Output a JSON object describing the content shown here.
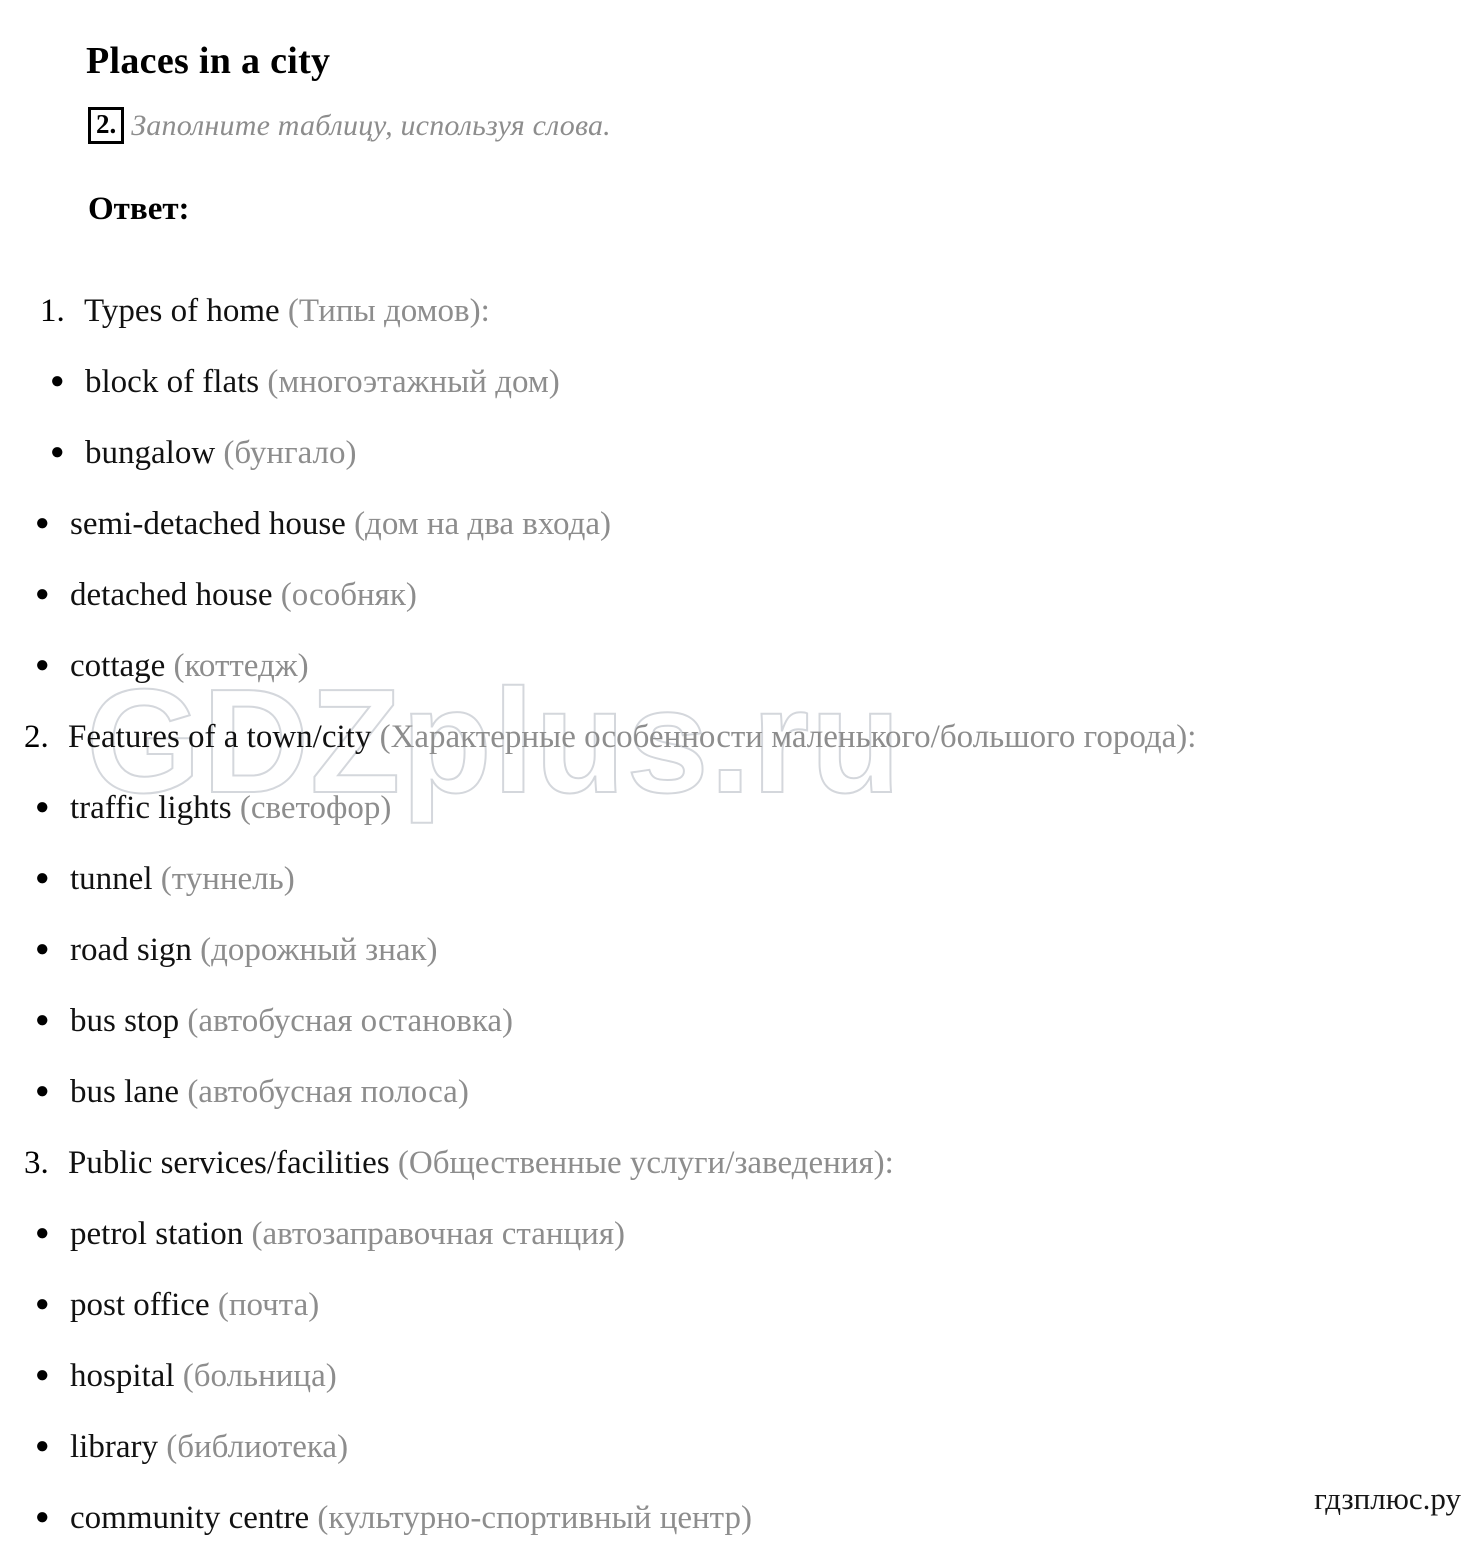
{
  "document": {
    "title": "Places in a city",
    "task": {
      "number": "2.",
      "instruction": "Заполните таблицу, используя слова."
    },
    "answer_label": "Ответ:"
  },
  "watermarks": {
    "center": "GDZplus.ru",
    "corner": "гдзплюс.ру"
  },
  "colors": {
    "text": "#111111",
    "translation": "#8d8d8d",
    "watermark": "#d4d7dc"
  },
  "sections": [
    {
      "number": "1.",
      "en": "Types of home",
      "ru": "(Типы домов):",
      "items": [
        {
          "en": "block of flats",
          "ru": "(многоэтажный дом)"
        },
        {
          "en": "bungalow",
          "ru": "(бунгало)"
        },
        {
          "en": "semi-detached house",
          "ru": "(дом на два входа)"
        },
        {
          "en": "detached house",
          "ru": "(особняк)"
        },
        {
          "en": "cottage",
          "ru": "(коттедж)"
        }
      ]
    },
    {
      "number": "2.",
      "en": "Features of a town/city",
      "ru": "(Характерные особенности маленького/большого города):",
      "items": [
        {
          "en": "traffic lights",
          "ru": "(светофор)"
        },
        {
          "en": "tunnel",
          "ru": "(туннель)"
        },
        {
          "en": "road sign",
          "ru": "(дорожный знак)"
        },
        {
          "en": "bus stop",
          "ru": "(автобусная остановка)"
        },
        {
          "en": "bus lane",
          "ru": "(автобусная полоса)"
        }
      ]
    },
    {
      "number": "3.",
      "en": "Public services/facilities",
      "ru": "(Общественные услуги/заведения):",
      "items": [
        {
          "en": "petrol station",
          "ru": "(автозаправочная станция)"
        },
        {
          "en": "post office",
          "ru": "(почта)"
        },
        {
          "en": "hospital",
          "ru": "(больница)"
        },
        {
          "en": "library",
          "ru": "(библиотека)"
        },
        {
          "en": "community centre",
          "ru": "(культурно-спортивный центр)"
        }
      ]
    }
  ],
  "bullet_glyph": "●"
}
